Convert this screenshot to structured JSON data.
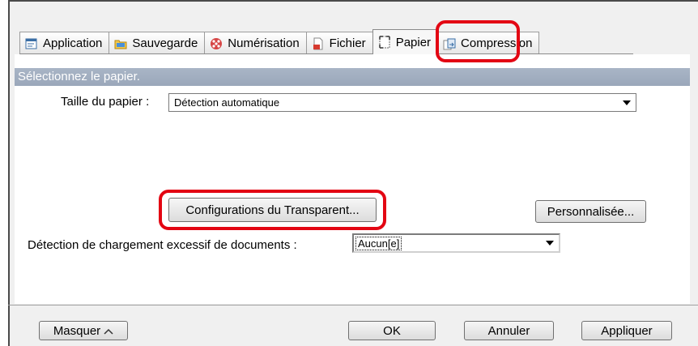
{
  "tabs": [
    {
      "label": "Application",
      "icon": "application-icon",
      "active": false
    },
    {
      "label": "Sauvegarde",
      "icon": "folder-icon",
      "active": false
    },
    {
      "label": "Numérisation",
      "icon": "scan-icon",
      "active": false
    },
    {
      "label": "Fichier",
      "icon": "file-icon",
      "active": false
    },
    {
      "label": "Papier",
      "icon": "paper-icon",
      "active": true
    },
    {
      "label": "Compression",
      "icon": "compression-icon",
      "active": false
    }
  ],
  "section": {
    "header": "Sélectionnez le papier."
  },
  "paper_size": {
    "label": "Taille du papier :",
    "value": "Détection automatique"
  },
  "buttons": {
    "transparent_config": "Configurations du Transparent...",
    "custom": "Personnalisée...",
    "hide": "Masquer",
    "ok": "OK",
    "cancel": "Annuler",
    "apply": "Appliquer"
  },
  "overload": {
    "label": "Détection de chargement excessif de documents :",
    "value": "Aucun[e]"
  },
  "colors": {
    "highlight": "#e30613",
    "section_header": "#9fabbd"
  }
}
